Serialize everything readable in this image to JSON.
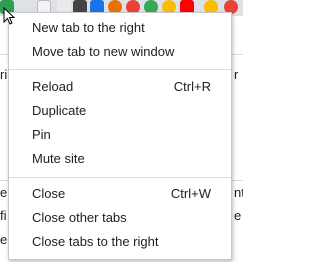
{
  "colors": {
    "menu_bg": "#ffffff",
    "menu_border": "#c8c8c8",
    "text": "#202124",
    "separator": "#dadce0",
    "tabstrip": "#dee1e6"
  },
  "background": {
    "tab_favicons": [
      "green-refresh-icon",
      "text-icon",
      "n-icon",
      "chess-icon",
      "download-icon",
      "red-circle-icon",
      "orange-circle-icon",
      "maps-pin-icon",
      "chrome-icon",
      "youtube-icon",
      "chrome-icon",
      "chrome-icon"
    ],
    "left_fragments": [
      "ri",
      "e'",
      "fi",
      "e"
    ],
    "right_fragments": [
      "r",
      "nt",
      "e"
    ]
  },
  "context_menu": {
    "groups": [
      {
        "items": [
          {
            "label": "New tab to the right",
            "shortcut": ""
          },
          {
            "label": "Move tab to new window",
            "shortcut": ""
          }
        ]
      },
      {
        "items": [
          {
            "label": "Reload",
            "shortcut": "Ctrl+R"
          },
          {
            "label": "Duplicate",
            "shortcut": ""
          },
          {
            "label": "Pin",
            "shortcut": ""
          },
          {
            "label": "Mute site",
            "shortcut": ""
          }
        ]
      },
      {
        "items": [
          {
            "label": "Close",
            "shortcut": "Ctrl+W"
          },
          {
            "label": "Close other tabs",
            "shortcut": ""
          },
          {
            "label": "Close tabs to the right",
            "shortcut": ""
          }
        ]
      }
    ]
  }
}
